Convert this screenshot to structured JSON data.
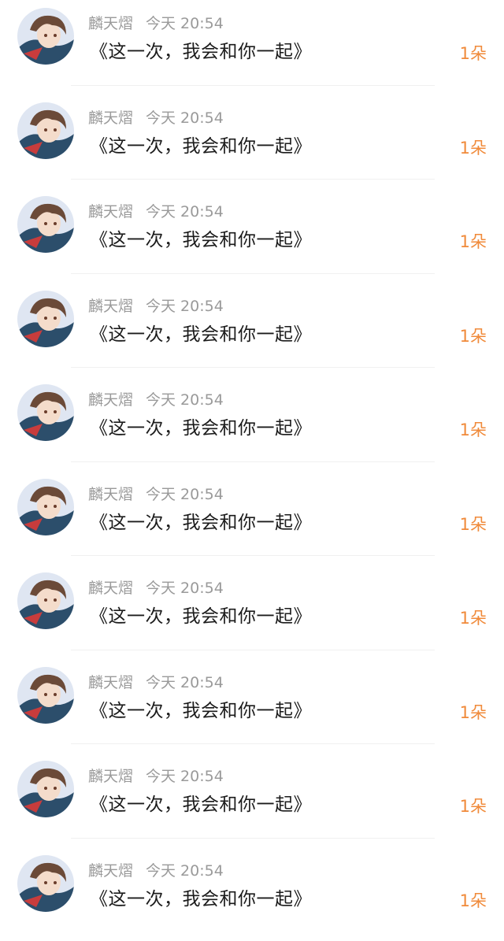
{
  "comments": [
    {
      "user": "麟天熠",
      "time": "今天 20:54",
      "text": "《这一次，我会和你一起》",
      "count": "1朵"
    },
    {
      "user": "麟天熠",
      "time": "今天 20:54",
      "text": "《这一次，我会和你一起》",
      "count": "1朵"
    },
    {
      "user": "麟天熠",
      "time": "今天 20:54",
      "text": "《这一次，我会和你一起》",
      "count": "1朵"
    },
    {
      "user": "麟天熠",
      "time": "今天 20:54",
      "text": "《这一次，我会和你一起》",
      "count": "1朵"
    },
    {
      "user": "麟天熠",
      "time": "今天 20:54",
      "text": "《这一次，我会和你一起》",
      "count": "1朵"
    },
    {
      "user": "麟天熠",
      "time": "今天 20:54",
      "text": "《这一次，我会和你一起》",
      "count": "1朵"
    },
    {
      "user": "麟天熠",
      "time": "今天 20:54",
      "text": "《这一次，我会和你一起》",
      "count": "1朵"
    },
    {
      "user": "麟天熠",
      "time": "今天 20:54",
      "text": "《这一次，我会和你一起》",
      "count": "1朵"
    },
    {
      "user": "麟天熠",
      "time": "今天 20:54",
      "text": "《这一次，我会和你一起》",
      "count": "1朵"
    },
    {
      "user": "麟天熠",
      "time": "今天 20:54",
      "text": "《这一次，我会和你一起》",
      "count": "1朵"
    }
  ],
  "colors": {
    "accent": "#f08a3a",
    "meta_text": "#9a9a9a",
    "body_text": "#1b1b1b"
  },
  "icons": {
    "avatar": "anime-character-avatar-icon"
  }
}
